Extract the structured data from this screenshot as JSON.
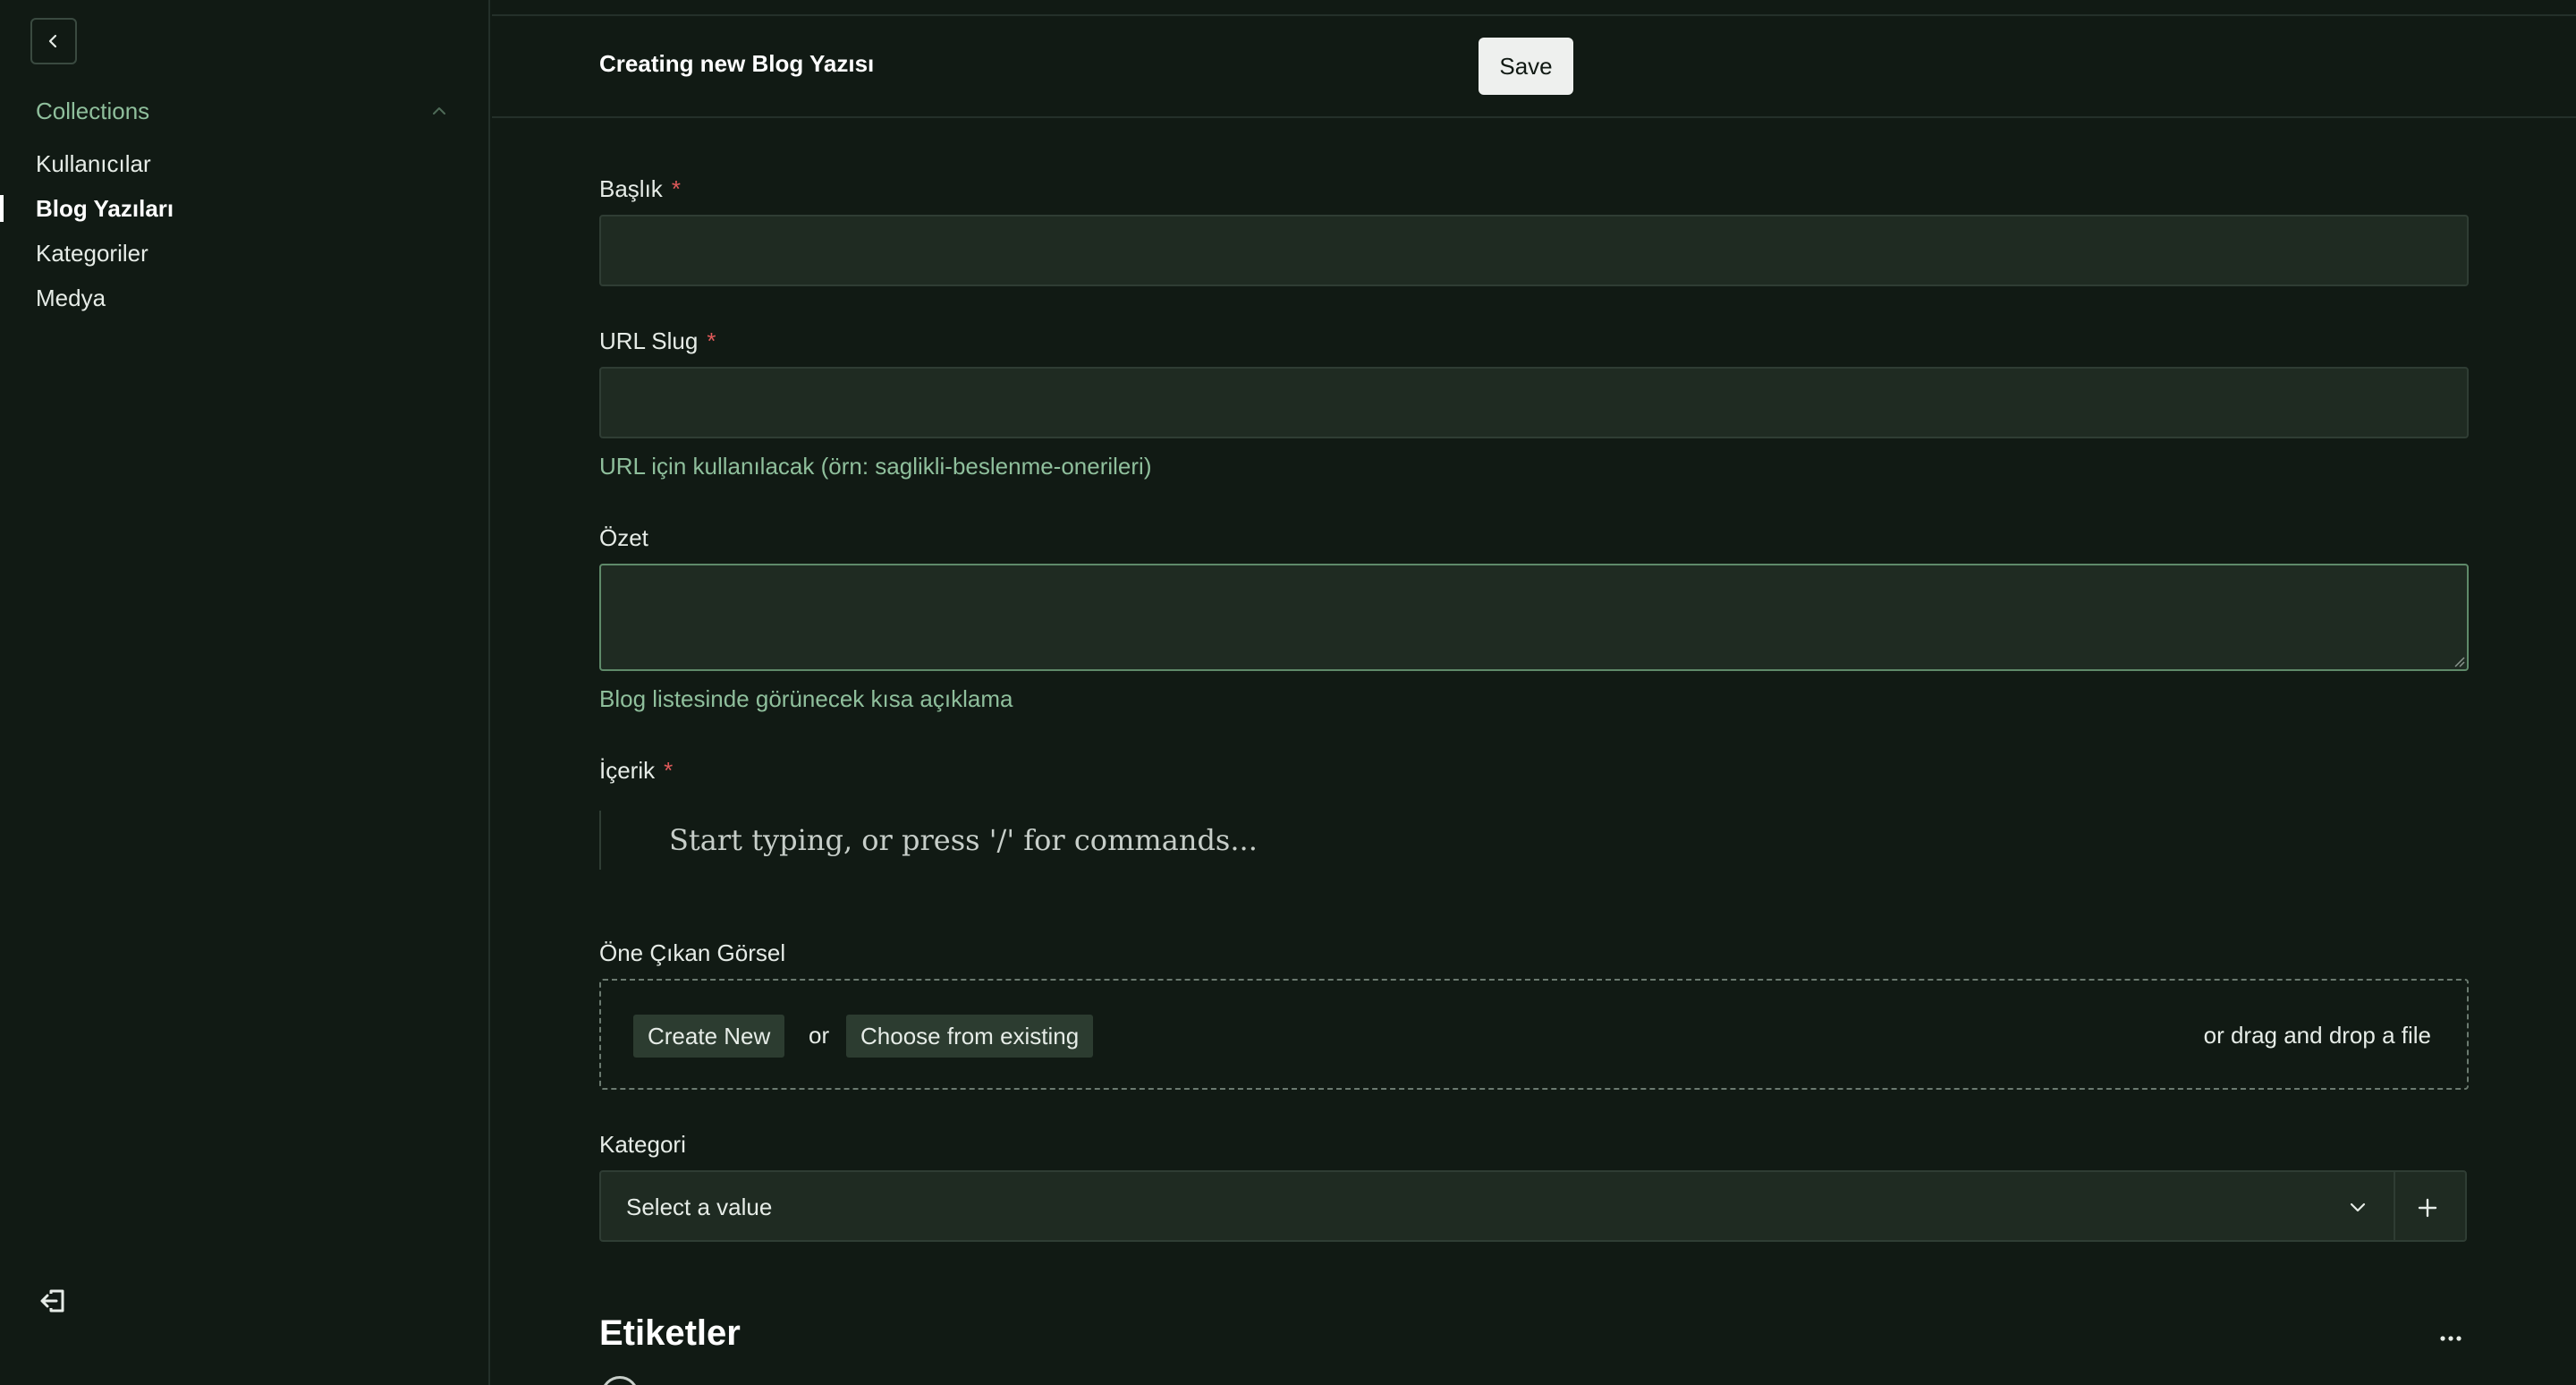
{
  "sidebar": {
    "collections_label": "Collections",
    "items": [
      {
        "label": "Kullanıcılar",
        "active": false
      },
      {
        "label": "Blog Yazıları",
        "active": true
      },
      {
        "label": "Kategoriler",
        "active": false
      },
      {
        "label": "Medya",
        "active": false
      }
    ],
    "icons": {
      "back": "chevron-left-icon",
      "collapse": "chevron-up-icon",
      "logout": "logout-icon"
    }
  },
  "header": {
    "title": "Creating new Blog Yazısı",
    "save_label": "Save"
  },
  "form": {
    "baslik": {
      "label": "Başlık",
      "required": "*",
      "value": ""
    },
    "slug": {
      "label": "URL Slug",
      "required": "*",
      "value": "",
      "hint": "URL için kullanılacak (örn: saglikli-beslenme-onerileri)"
    },
    "ozet": {
      "label": "Özet",
      "value": "",
      "hint": "Blog listesinde görünecek kısa açıklama"
    },
    "icerik": {
      "label": "İçerik",
      "required": "*",
      "placeholder": "Start typing, or press '/' for commands..."
    },
    "gorsel": {
      "label": "Öne Çıkan Görsel",
      "create_new": "Create New",
      "or": "or",
      "choose_existing": "Choose from existing",
      "drop_text": "or drag and drop a file"
    },
    "kategori": {
      "label": "Kategori",
      "placeholder": "Select a value"
    },
    "etiketler": {
      "title": "Etiketler"
    }
  },
  "colors": {
    "background": "#111a14",
    "input_bg": "#1f2b22",
    "accent": "#8fbf9c",
    "required": "#e05a5a"
  }
}
